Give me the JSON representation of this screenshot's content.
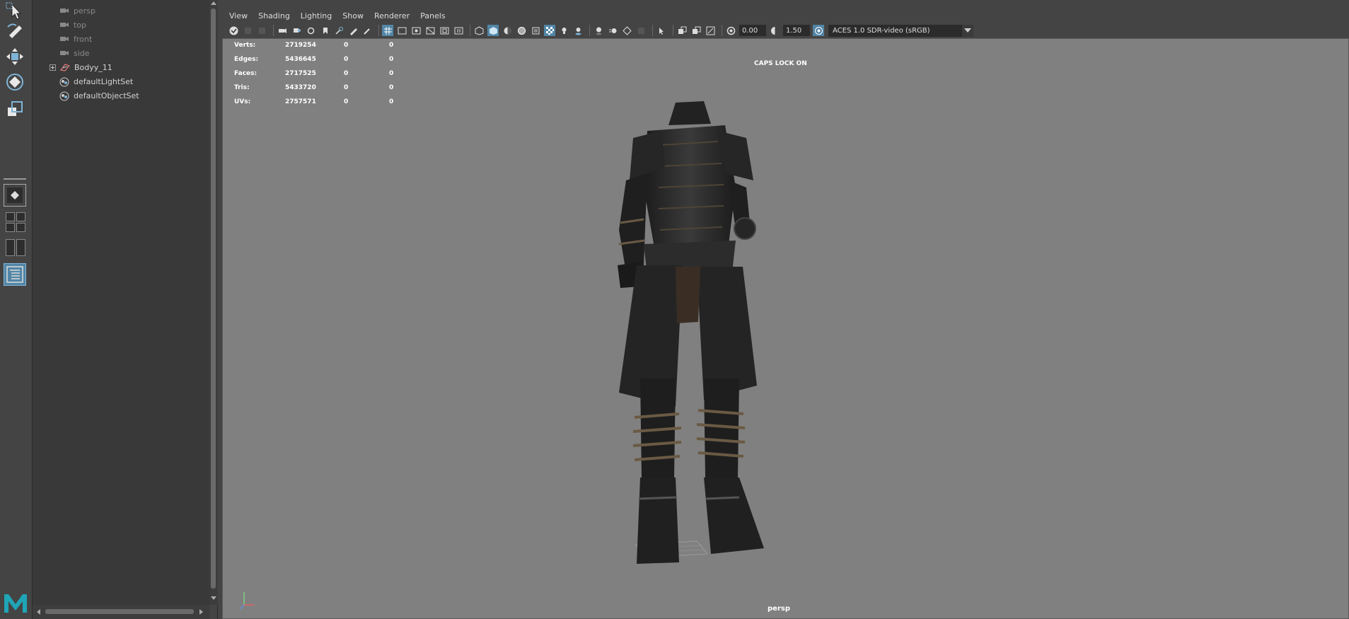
{
  "outliner": {
    "items": [
      {
        "label": "persp",
        "dim": true
      },
      {
        "label": "top",
        "dim": true
      },
      {
        "label": "front",
        "dim": true
      },
      {
        "label": "side",
        "dim": true
      },
      {
        "label": "Bodyy_11",
        "dim": false
      },
      {
        "label": "defaultLightSet",
        "dim": false
      },
      {
        "label": "defaultObjectSet",
        "dim": false
      }
    ]
  },
  "panel": {
    "menus": [
      "View",
      "Shading",
      "Lighting",
      "Show",
      "Renderer",
      "Panels"
    ],
    "exposure": "0.00",
    "gamma": "1.50",
    "color_management": "ACES 1.0 SDR-video (sRGB)"
  },
  "hud": {
    "rows": [
      {
        "label": "Verts:",
        "total": "2719254",
        "sel": "0",
        "comp": "0"
      },
      {
        "label": "Edges:",
        "total": "5436645",
        "sel": "0",
        "comp": "0"
      },
      {
        "label": "Faces:",
        "total": "2717525",
        "sel": "0",
        "comp": "0"
      },
      {
        "label": "Tris:",
        "total": "5433720",
        "sel": "0",
        "comp": "0"
      },
      {
        "label": "UVs:",
        "total": "2757571",
        "sel": "0",
        "comp": "0"
      }
    ],
    "caps_lock": "CAPS LOCK ON",
    "camera": "persp"
  },
  "colors": {
    "viewport_bg": "#808080",
    "ui_bg": "#444444",
    "highlight": "#5285a6",
    "maya_logo": "#1fa5b8"
  }
}
